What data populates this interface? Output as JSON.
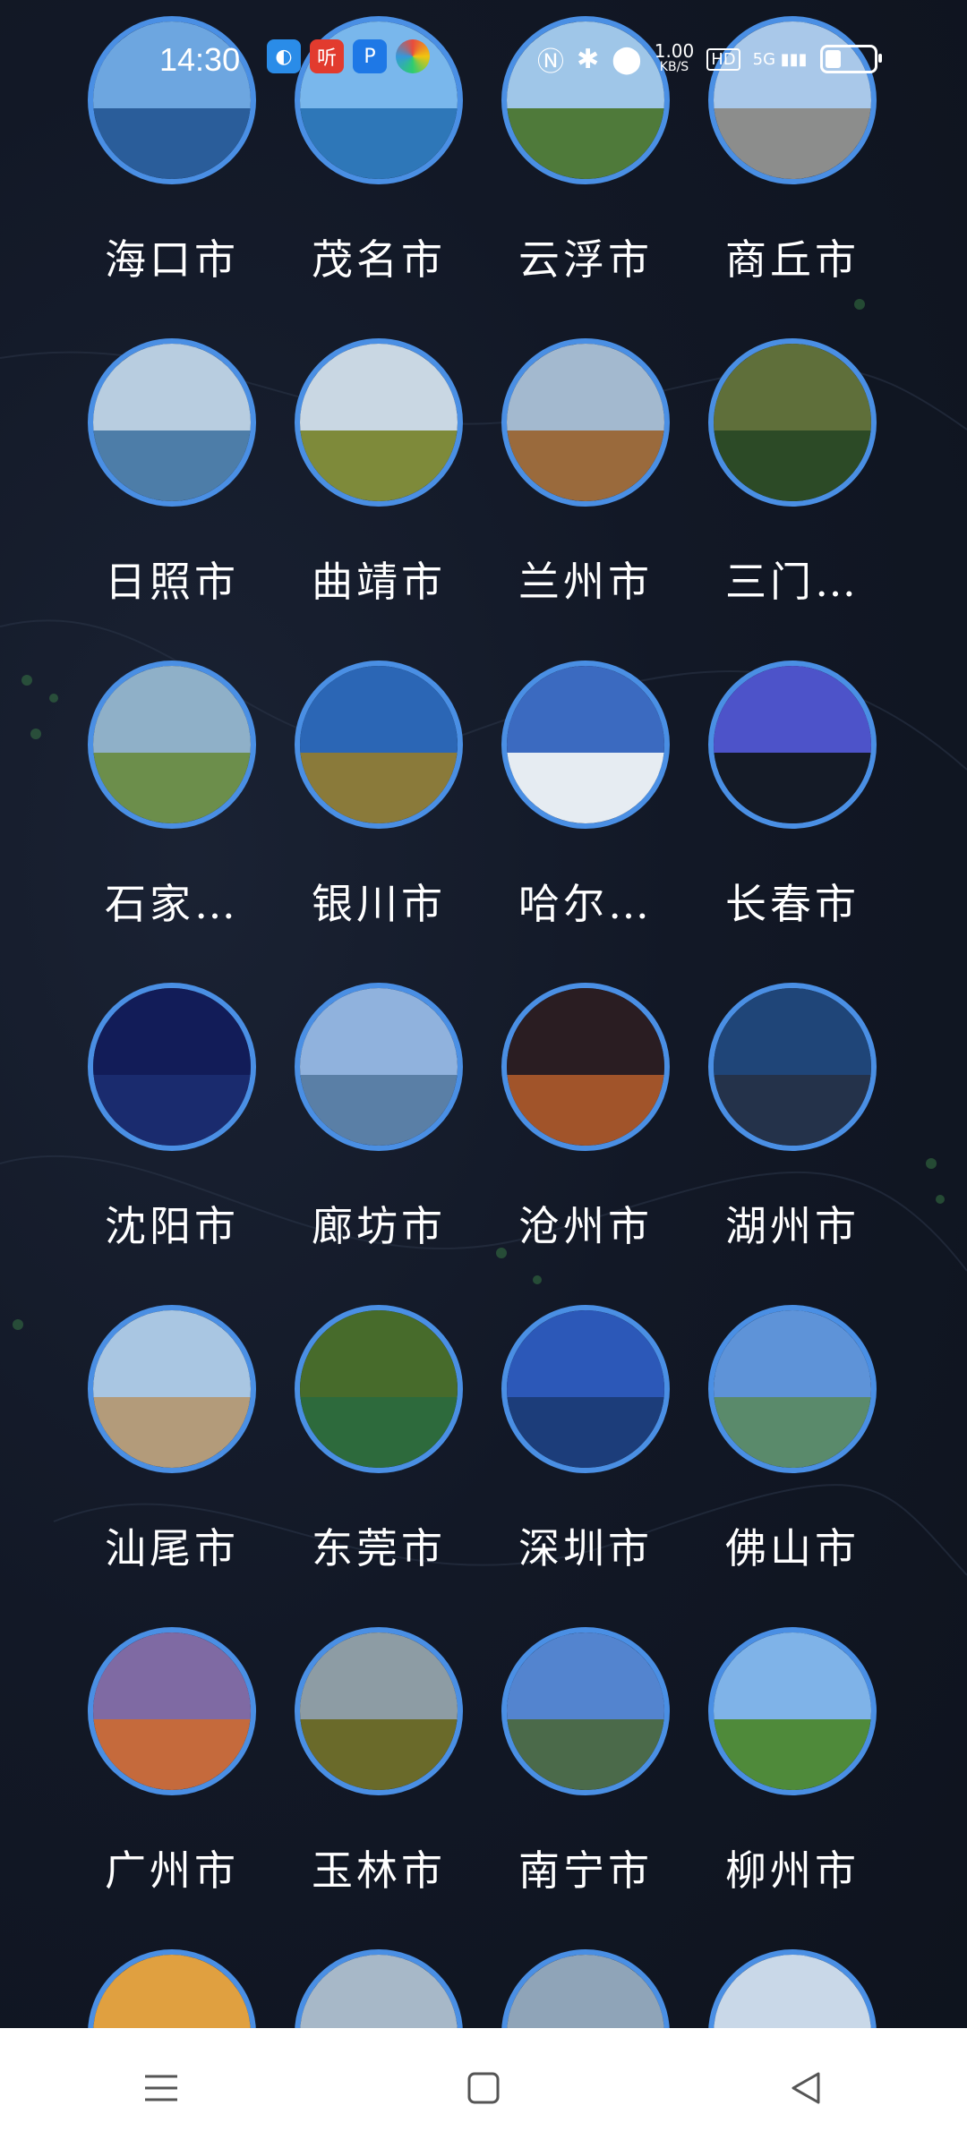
{
  "status_bar": {
    "time": "14:30",
    "speed_value": "1.00",
    "speed_unit": "KB/S",
    "hd": "HD",
    "network": "5G",
    "app_icons": [
      "browser-icon",
      "ting-icon",
      "p-icon",
      "colorful-app-icon"
    ],
    "system_icons": [
      "nfc-icon",
      "bluetooth-icon",
      "location-icon",
      "hd-icon",
      "signal-5g-icon",
      "battery-icon"
    ]
  },
  "cities": [
    {
      "label": "海口市",
      "sky": "#6da6e0",
      "ground": "#2a5d9a"
    },
    {
      "label": "茂名市",
      "sky": "#79b7ec",
      "ground": "#2e77b8"
    },
    {
      "label": "云浮市",
      "sky": "#9fc6e8",
      "ground": "#4f7a3a"
    },
    {
      "label": "商丘市",
      "sky": "#a9c8e9",
      "ground": "#8c8d8c"
    },
    {
      "label": "日照市",
      "sky": "#b8cde0",
      "ground": "#4d7da8"
    },
    {
      "label": "曲靖市",
      "sky": "#c9d7e3",
      "ground": "#7e8a3a"
    },
    {
      "label": "兰州市",
      "sky": "#a3b9cf",
      "ground": "#9a6a3c"
    },
    {
      "label": "三门…",
      "sky": "#5f6f3a",
      "ground": "#2c4a26"
    },
    {
      "label": "石家…",
      "sky": "#8fb0c8",
      "ground": "#6c8e4b"
    },
    {
      "label": "银川市",
      "sky": "#2b66b5",
      "ground": "#8a7a3a"
    },
    {
      "label": "哈尔…",
      "sky": "#3b6ac0",
      "ground": "#e6ecf2"
    },
    {
      "label": "长春市",
      "sky": "#4d53c9",
      "ground": "#141a26"
    },
    {
      "label": "沈阳市",
      "sky": "#121c58",
      "ground": "#1a2b6e"
    },
    {
      "label": "廊坊市",
      "sky": "#90b2dd",
      "ground": "#5a7fa6"
    },
    {
      "label": "沧州市",
      "sky": "#2a1d22",
      "ground": "#a1542a"
    },
    {
      "label": "湖州市",
      "sky": "#1f4578",
      "ground": "#24324a"
    },
    {
      "label": "汕尾市",
      "sky": "#a9c6e2",
      "ground": "#b39b7a"
    },
    {
      "label": "东莞市",
      "sky": "#476b2b",
      "ground": "#2d6a3c"
    },
    {
      "label": "深圳市",
      "sky": "#2c58b8",
      "ground": "#1c3d7a"
    },
    {
      "label": "佛山市",
      "sky": "#5e93d8",
      "ground": "#5a8a6b"
    },
    {
      "label": "广州市",
      "sky": "#7f6aa3",
      "ground": "#c56a3c"
    },
    {
      "label": "玉林市",
      "sky": "#8d9ca4",
      "ground": "#6a6a2a"
    },
    {
      "label": "南宁市",
      "sky": "#5384cf",
      "ground": "#4b6a4a"
    },
    {
      "label": "柳州市",
      "sky": "#7fb3e8",
      "ground": "#4f8a3a"
    },
    {
      "label": "",
      "sky": "#e0a040",
      "ground": "#553a2a"
    },
    {
      "label": "",
      "sky": "#a7b8c8",
      "ground": "#5c7048"
    },
    {
      "label": "",
      "sky": "#8fa4b8",
      "ground": "#3a2a22"
    },
    {
      "label": "",
      "sky": "#c9d8e8",
      "ground": "#a34a2a"
    }
  ],
  "nav": {
    "menu": "menu-icon",
    "home": "home-icon",
    "back": "back-icon"
  }
}
